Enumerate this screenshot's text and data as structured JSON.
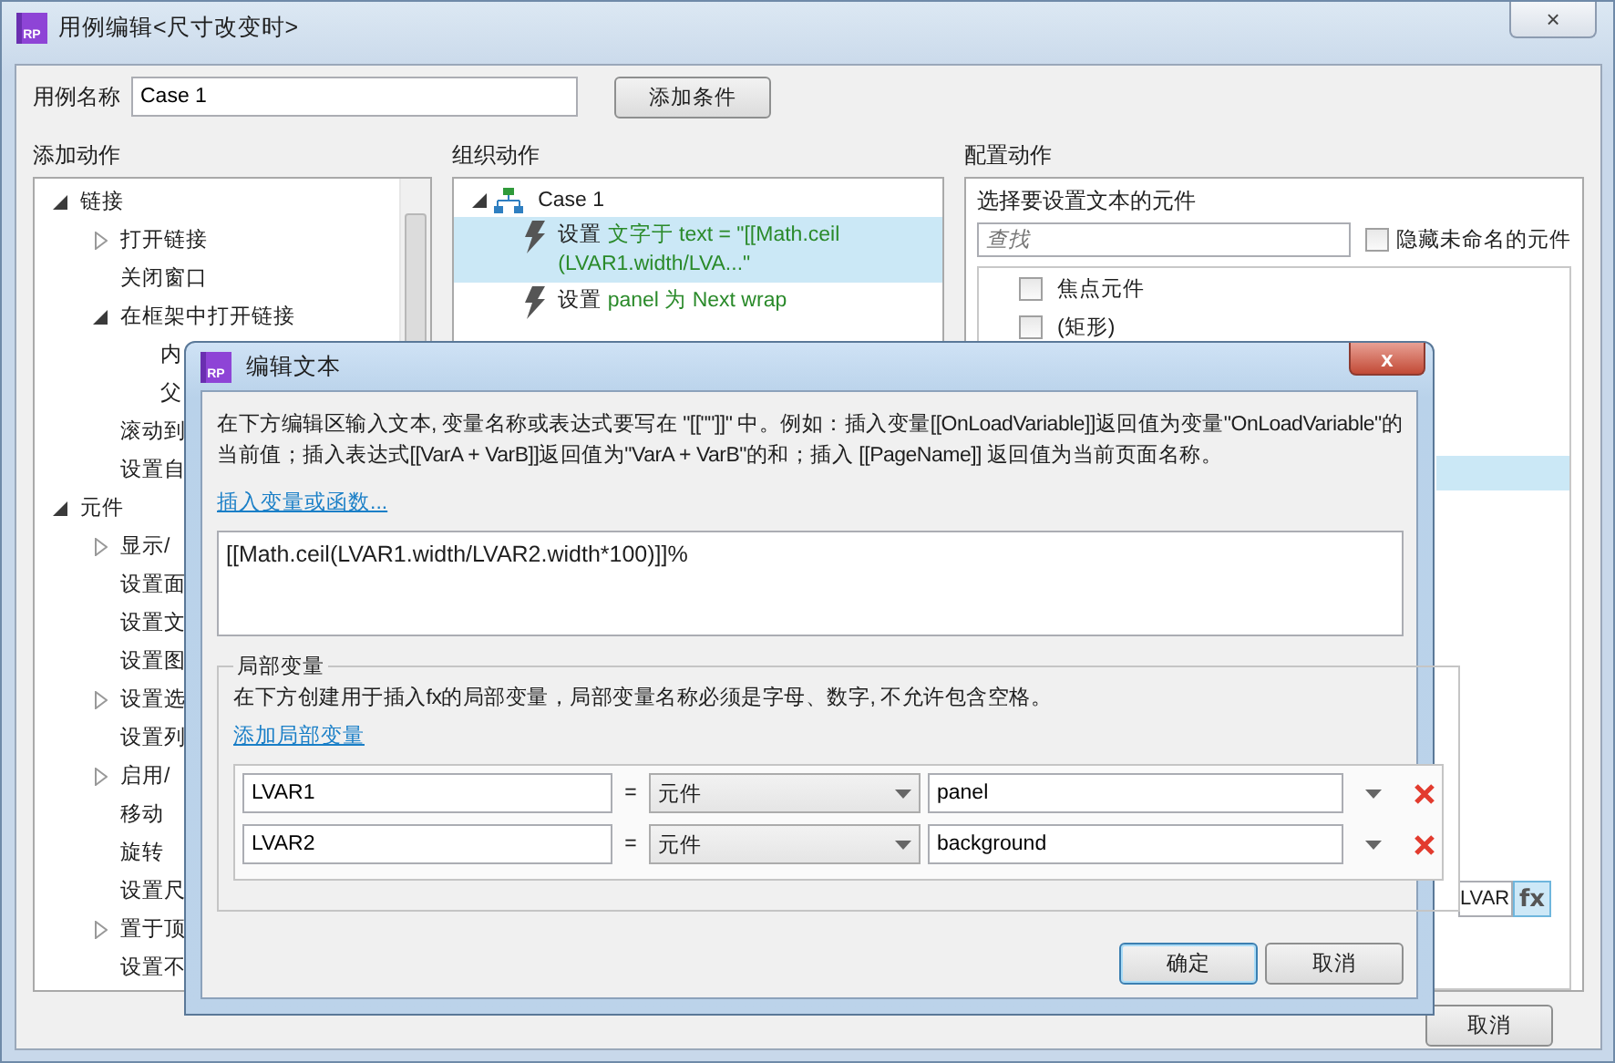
{
  "window": {
    "icon": "RP",
    "title": "用例编辑<尺寸改变时>",
    "close": "×"
  },
  "case_name": {
    "label": "用例名称",
    "value": "Case 1"
  },
  "add_condition_button": "添加条件",
  "sections": [
    "添加动作",
    "组织动作",
    "配置动作"
  ],
  "actions_tree": [
    {
      "label": "链接",
      "expanded": true,
      "children": [
        {
          "label": "打开链接",
          "expanded": false
        },
        {
          "label": "关闭窗口"
        },
        {
          "label": "在框架中打开链接",
          "expanded": true,
          "children": [
            {
              "label": "内"
            },
            {
              "label": "父"
            }
          ]
        },
        {
          "label": "滚动到"
        },
        {
          "label": "设置自"
        }
      ]
    },
    {
      "label": "元件",
      "expanded": true,
      "children": [
        {
          "label": "显示/",
          "expanded": false
        },
        {
          "label": "设置面"
        },
        {
          "label": "设置文"
        },
        {
          "label": "设置图"
        },
        {
          "label": "设置选",
          "expanded": false
        },
        {
          "label": "设置列"
        },
        {
          "label": "启用/",
          "expanded": false
        },
        {
          "label": "移动"
        },
        {
          "label": "旋转"
        },
        {
          "label": "设置尺"
        },
        {
          "label": "置于顶",
          "expanded": false
        },
        {
          "label": "设置不"
        }
      ]
    }
  ],
  "organize": {
    "case": "Case 1",
    "expanded": true,
    "actions": [
      {
        "verb": "设置",
        "detail": "文字于 text = \"[[Math.ceil (LVAR1.width/LVA...\"",
        "selected": true
      },
      {
        "verb": "设置",
        "detail": "panel 为 Next wrap",
        "selected": false
      }
    ]
  },
  "configure": {
    "heading": "选择要设置文本的元件",
    "search_placeholder": "查找",
    "hide_unnamed": {
      "label": "隐藏未命名的元件",
      "checked": false
    },
    "widgets": [
      {
        "label": "焦点元件",
        "checked": false
      },
      {
        "label": "(矩形)",
        "checked": false
      }
    ],
    "hidden_row": {
      "selected": true
    },
    "value_field": "LVAR",
    "fx_button": "fx"
  },
  "footer_buttons": [
    "取消"
  ],
  "dialog": {
    "icon": "RP",
    "title": "编辑文本",
    "close": "x",
    "description": "在下方编辑区输入文本, 变量名称或表达式要写在 \"[[\"\"]]\" 中。例如：插入变量[[OnLoadVariable]]返回值为变量\"OnLoadVariable\"的当前值；插入表达式[[VarA + VarB]]返回值为\"VarA + VarB\"的和；插入 [[PageName]] 返回值为当前页面名称。",
    "insert_link": "插入变量或函数...",
    "expression": "[[Math.ceil(LVAR1.width/LVAR2.width*100)]]%",
    "locals": {
      "legend": "局部变量",
      "description": "在下方创建用于插入fx的局部变量，局部变量名称必须是字母、数字, 不允许包含空格。",
      "add_link": "添加局部变量",
      "rows": [
        {
          "name": "LVAR1",
          "equals": "=",
          "type": "元件",
          "target": "panel"
        },
        {
          "name": "LVAR2",
          "equals": "=",
          "type": "元件",
          "target": "background"
        }
      ]
    },
    "buttons": [
      {
        "label": "确定",
        "default": true
      },
      {
        "label": "取消",
        "default": false
      }
    ]
  }
}
